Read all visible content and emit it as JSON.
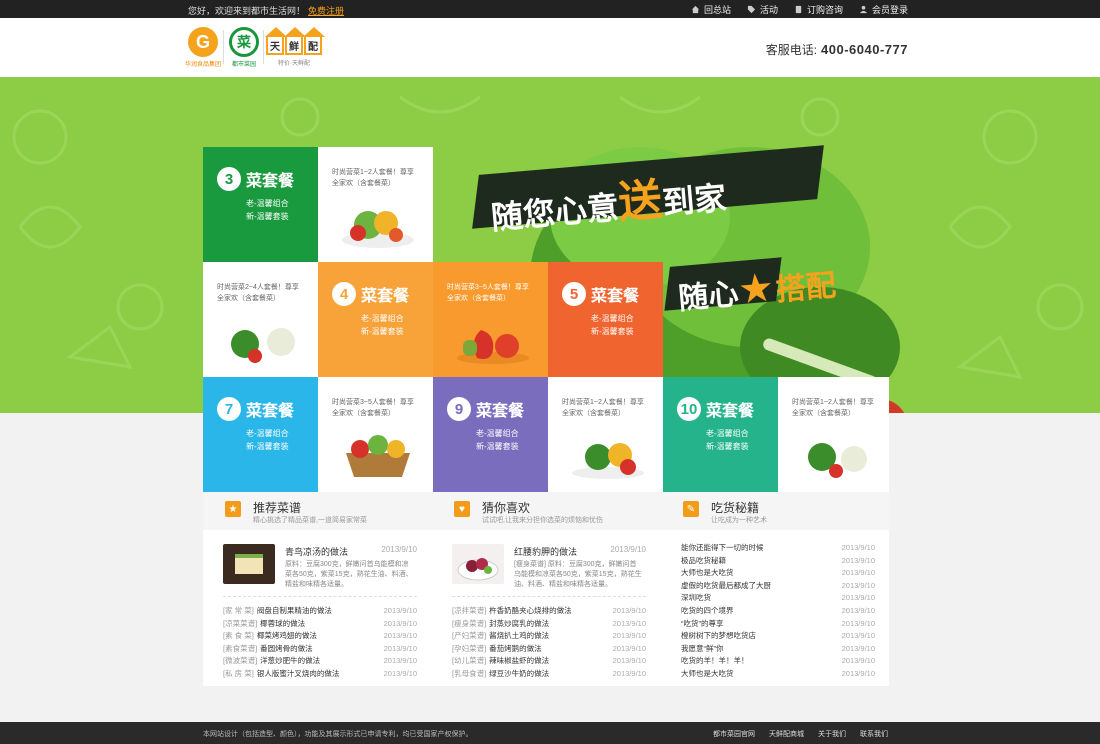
{
  "topbar": {
    "greeting": "您好，欢迎来到都市生活网！",
    "register": "免费注册",
    "links": [
      "回总站",
      "活动",
      "订购咨询",
      "会员登录"
    ]
  },
  "header": {
    "logo1_char": "G",
    "logo1_caption": "华润食品集团",
    "logo2_char": "菜",
    "logo2_caption": "都市菜园",
    "logo3_chars": [
      "天",
      "鲜",
      "配"
    ],
    "logo3_caption": "特价·天鲜配",
    "hotline_label": "客服电话:",
    "hotline_number": "400-6040-777"
  },
  "banner": {
    "slogan1": "随您心意",
    "slogan1_big": "送",
    "slogan1_tail": "到家",
    "slogan2_a": "随心",
    "slogan2_star": "★",
    "slogan2_b": "搭配"
  },
  "packages": [
    {
      "num": "3",
      "title": "菜套餐",
      "line1": "老-温馨组合",
      "line2": "新-温馨套装",
      "desc": "时尚营菜1~2人套餐！尊享全家欢（含套餐菜）"
    },
    {
      "num": "4",
      "title": "菜套餐",
      "line1": "老-温馨组合",
      "line2": "新-温馨套装",
      "desc": "时尚营菜2~4人套餐！尊享全家欢（含套餐菜）"
    },
    {
      "num": "5",
      "title": "菜套餐",
      "line1": "老-温馨组合",
      "line2": "新-温馨套装",
      "desc": "时尚营菜3~5人套餐！尊享全家欢（含套餐菜）"
    },
    {
      "num": "7",
      "title": "菜套餐",
      "line1": "老-温馨组合",
      "line2": "新-温馨套装",
      "desc": "时尚营菜3~5人套餐！尊享全家欢（含套餐菜）"
    },
    {
      "num": "9",
      "title": "菜套餐",
      "line1": "老-温馨组合",
      "line2": "新-温馨套装",
      "desc": "时尚营菜1~2人套餐！尊享全家欢（含套餐菜）"
    },
    {
      "num": "10",
      "title": "菜套餐",
      "line1": "老-温馨组合",
      "line2": "新-温馨套装",
      "desc": "时尚营菜1~2人套餐！尊享全家欢（含套餐菜）"
    }
  ],
  "sections": [
    {
      "title": "推荐菜谱",
      "sub": "精心挑选了精品菜谱,一道简易家常菜",
      "icon": "★",
      "feature": {
        "title": "青鸟凉汤的做法",
        "date": "2013/9/10",
        "desc": "原料：豆腐300克，鲜嫩问首乌能模和凉菜各50克，紫菜15克，熟花生油、料酒、精盐和味精各适量。"
      },
      "items": [
        {
          "cat": "[家 常 菜]",
          "title": "阀盘自制果精油的做法",
          "date": "2013/9/10"
        },
        {
          "cat": "[凉菜菜谱]",
          "title": "椰蓉球的做法",
          "date": "2013/9/10"
        },
        {
          "cat": "[素 食 菜]",
          "title": "椰菜烤鸡翅的做法",
          "date": "2013/9/10"
        },
        {
          "cat": "[素食菜谱]",
          "title": "番圆烤骨的做法",
          "date": "2013/9/10"
        },
        {
          "cat": "[微波菜谱]",
          "title": "洋葱炒肥牛的做法",
          "date": "2013/9/10"
        },
        {
          "cat": "[私 房 菜]",
          "title": "银人版蜜汁叉烧肉的做法",
          "date": "2013/9/10"
        }
      ]
    },
    {
      "title": "猜你喜欢",
      "sub": "试试吧,让我来分担你选菜的烦恼和忧伤",
      "icon": "♥",
      "feature": {
        "title": "红腰豹胛的做法",
        "date": "2013/9/10",
        "desc": "[瘦身菜谱] 原料：豆腐300克，鲜嫩问首乌能模和凉菜各50克，紫菜15克，熟花生油、料酒、精盐和味精各适量。"
      },
      "items": [
        {
          "cat": "[凉拌菜谱]",
          "title": "杵香奶酪夹心烧排的做法",
          "date": "2013/9/10"
        },
        {
          "cat": "[瘦身菜谱]",
          "title": "封蒸炒腐乳的做法",
          "date": "2013/9/10"
        },
        {
          "cat": "[产妇菜谱]",
          "title": "酱烧扒土鸡的做法",
          "date": "2013/9/10"
        },
        {
          "cat": "[孕妇菜谱]",
          "title": "番茄烤鹅的做法",
          "date": "2013/9/10"
        },
        {
          "cat": "[幼儿菜谱]",
          "title": "辣味椒盐虾的做法",
          "date": "2013/9/10"
        },
        {
          "cat": "[乳母食谱]",
          "title": "绿豆沙牛奶的做法",
          "date": "2013/9/10"
        }
      ]
    },
    {
      "title": "吃货秘籍",
      "sub": "让吃成为一种艺术",
      "icon": "✎",
      "feature": null,
      "items": [
        {
          "cat": "",
          "title": "能你还能得下一切的时候",
          "date": "2013/9/10"
        },
        {
          "cat": "",
          "title": "极品吃货秘籍",
          "date": "2013/9/10"
        },
        {
          "cat": "",
          "title": "大师也是大吃货",
          "date": "2013/9/10"
        },
        {
          "cat": "",
          "title": "虚假的吃货最后都成了大厨",
          "date": "2013/9/10"
        },
        {
          "cat": "",
          "title": "深圳吃货",
          "date": "2013/9/10"
        },
        {
          "cat": "",
          "title": "吃货的四个境界",
          "date": "2013/9/10"
        },
        {
          "cat": "",
          "title": "“吃货”的尊享",
          "date": "2013/9/10"
        },
        {
          "cat": "",
          "title": "橙树树下的梦想吃货店",
          "date": "2013/9/10"
        },
        {
          "cat": "",
          "title": "我愿意“鲜”你",
          "date": "2013/9/10"
        },
        {
          "cat": "",
          "title": "吃货的羊！羊！羊！",
          "date": "2013/9/10"
        },
        {
          "cat": "",
          "title": "大师也是大吃货",
          "date": "2013/9/10"
        }
      ]
    }
  ],
  "footer": {
    "copy": "本网站设计（包括造型、颜色），功能及其展示形式已申请专利，均已受国家产权保护。",
    "links": [
      "都市菜园官网",
      "天鲜配商城",
      "关于我们",
      "联系我们"
    ]
  }
}
